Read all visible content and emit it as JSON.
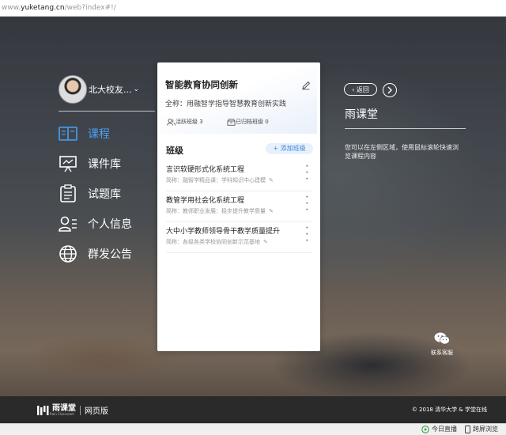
{
  "browser": {
    "url_scheme": "www.",
    "url_host": "yuketang.cn",
    "url_path": "/web?index#!/"
  },
  "profile": {
    "name": "北大校友...",
    "caret": "⌄"
  },
  "nav": {
    "items": [
      {
        "label": "课程",
        "icon": "book-icon",
        "active": true
      },
      {
        "label": "课件库",
        "icon": "presentation-icon",
        "active": false
      },
      {
        "label": "试题库",
        "icon": "clipboard-list-icon",
        "active": false
      },
      {
        "label": "个人信息",
        "icon": "user-card-icon",
        "active": false
      },
      {
        "label": "群发公告",
        "icon": "globe-icon",
        "active": false
      }
    ]
  },
  "course": {
    "title": "智能教育协同创新",
    "full_name": "全称：用融智学指导智慧教育创新实践",
    "active_classes": "活跃班级 3",
    "archived_classes": "已归档班级 0"
  },
  "classes": {
    "heading": "班级",
    "add_label": "+ 添加班级",
    "items": [
      {
        "name": "言识软硬形式化系统工程",
        "desc": "简称：融智学精品课：学科知识中心建模"
      },
      {
        "name": "教管学用社会化系统工程",
        "desc": "简称：教师职业发展：稳步提升教学质量"
      },
      {
        "name": "大中小学教师领导骨干教学质量提升",
        "desc": "简称：各级各类学校协同创新示范基地"
      }
    ]
  },
  "right_panel": {
    "back_label": "返回",
    "title": "雨课堂",
    "tip": "您可以在左侧区域，使用鼠标滚轮快速浏览课程内容"
  },
  "contact": {
    "label": "联系客服"
  },
  "footer": {
    "brand": "雨课堂",
    "brand_sub": "Rain Classroom",
    "web_label": "网页版",
    "copyright": "© 2018 清华大学 & 学堂在线"
  },
  "statusbar": {
    "live_label": "今日直播",
    "screen_label": "跨屏浏览"
  },
  "colors": {
    "accent": "#4a9ff5",
    "footer_bg": "#2a2a2a"
  }
}
